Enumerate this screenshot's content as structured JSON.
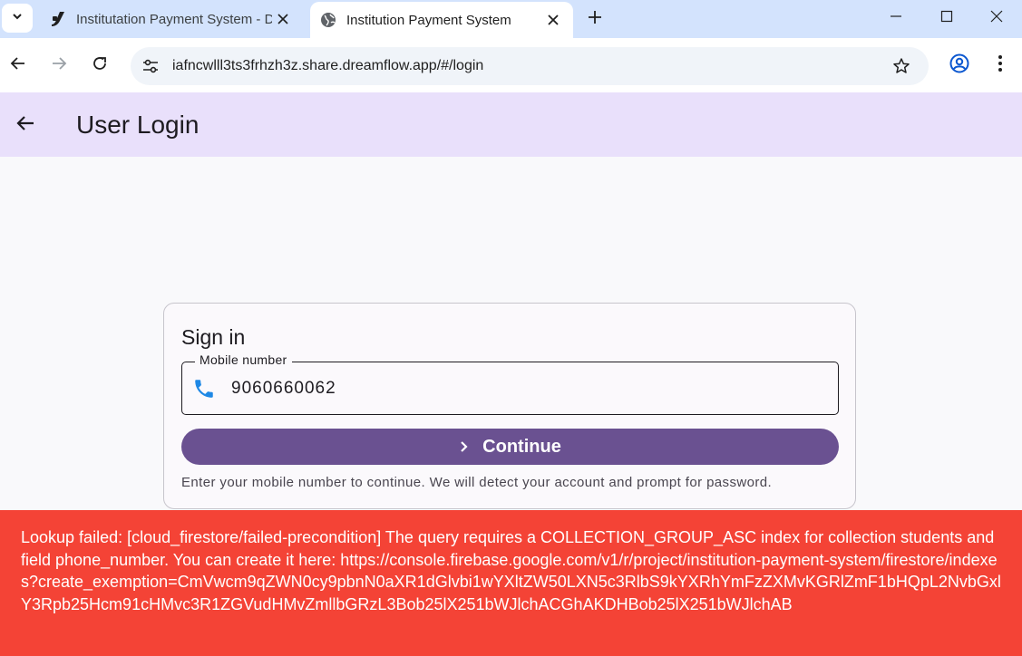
{
  "browser": {
    "tabs": [
      {
        "title": "Institutation Payment System - D",
        "favicon": "dreamflow-icon"
      },
      {
        "title": "Institution Payment System",
        "favicon": "globe-icon",
        "active": true
      }
    ],
    "url": "iafncwlll3ts3frhzh3z.share.dreamflow.app/#/login"
  },
  "appbar": {
    "title": "User Login"
  },
  "signin": {
    "heading": "Sign in",
    "field_label": "Mobile number",
    "field_value": "9060660062",
    "button_label": "Continue",
    "hint": "Enter your mobile number to continue. We will detect your account and prompt for password."
  },
  "error": {
    "message": "Lookup failed: [cloud_firestore/failed-precondition] The query requires a COLLECTION_GROUP_ASC index for collection students and field phone_number. You can create it here: https://console.firebase.google.com/v1/r/project/institution-payment-system/firestore/indexes?create_exemption=CmVwcm9qZWN0cy9pbnN0aXR1dGlvbi1wYXltZW50LXN5c3RlbS9kYXRhYmFzZXMvKGRlZmF1bHQpL2NvbGxlY3Rpb25Hcm91cHMvc3R1ZGVudHMvZmllbGRzL3Bob25lX251bWJlchACGhAKDHBob25lX251bWJlchAB"
  },
  "colors": {
    "appbar": "#e9e0fb",
    "button": "#6a5191",
    "error": "#f44336",
    "phone_icon": "#1e88e5"
  }
}
